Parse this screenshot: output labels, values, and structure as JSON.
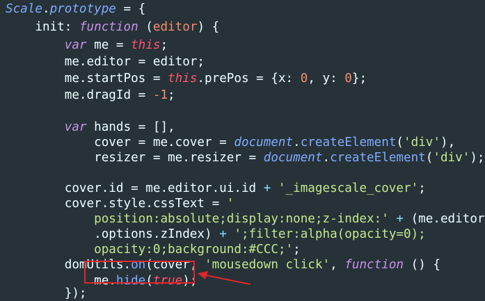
{
  "code": {
    "l1": {
      "a": "Scale",
      "b": ".",
      "c": "prototype",
      "d": " = {"
    },
    "l2": {
      "a": "    init",
      "b": ": ",
      "c": "function",
      "d": " (",
      "e": "editor",
      "f": ") {"
    },
    "l3": {
      "a": "        ",
      "b": "var",
      "c": " me = ",
      "d": "this",
      "e": ";"
    },
    "l4": {
      "a": "        me.editor = editor;"
    },
    "l5": {
      "a": "        me.startPos = ",
      "b": "this",
      "c": ".prePos = {x: ",
      "d": "0",
      "e": ", y: ",
      "f": "0",
      "g": "};"
    },
    "l6": {
      "a": "        me.dragId = ",
      "b": "-1",
      "c": ";"
    },
    "l7": {
      "a": ""
    },
    "l8": {
      "a": "        ",
      "b": "var",
      "c": " hands = [],"
    },
    "l9": {
      "a": "            cover = me.cover = ",
      "b": "document",
      "c": ".",
      "d": "createElement",
      "e": "(",
      "f": "'div'",
      "g": "),"
    },
    "l10": {
      "a": "            resizer = me.resizer = ",
      "b": "document",
      "c": ".",
      "d": "createElement",
      "e": "(",
      "f": "'div'",
      "g": ");"
    },
    "l11": {
      "a": ""
    },
    "l12": {
      "a": "        cover.id = me.editor.ui.id ",
      "b": "+",
      "c": " ",
      "d": "'_imagescale_cover'",
      "e": ";"
    },
    "l13": {
      "a": "        cover.style.cssText = ",
      "b": "'"
    },
    "l14": {
      "a": "            ",
      "b": "position:absolute;display:none;z-index:'",
      "c": " ",
      "d": "+",
      "e": " (me.editor"
    },
    "l15": {
      "a": "            .options.zIndex) ",
      "b": "+",
      "c": " ",
      "d": "';filter:alpha(opacity=0);"
    },
    "l16": {
      "a": "            ",
      "b": "opacity:0;background:#CCC;'",
      "c": ";"
    },
    "l17": {
      "a": "        domUtils.",
      "b": "on",
      "c": "(cover, ",
      "d": "'mousedown click'",
      "e": ", ",
      "f": "function",
      "g": " () {"
    },
    "l18": {
      "a": "            me.",
      "b": "hide",
      "c": "(",
      "d": "true",
      "e": ");"
    },
    "l19": {
      "a": "        });"
    }
  },
  "colors": {
    "background": "#263238",
    "annotation": "#e0252c"
  }
}
